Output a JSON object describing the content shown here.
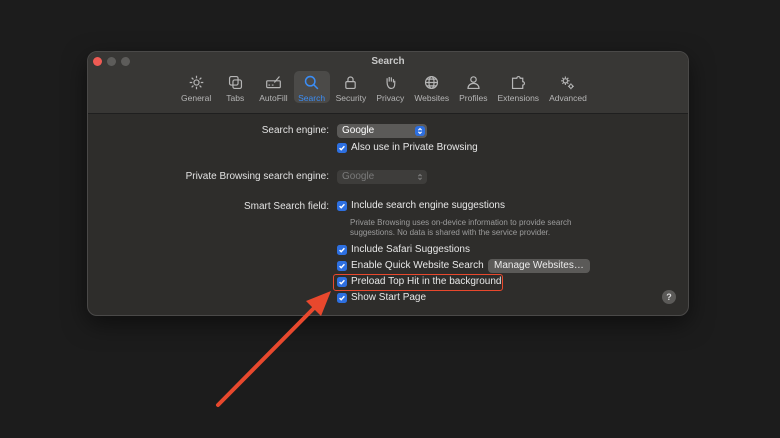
{
  "window": {
    "title": "Search"
  },
  "tabs": [
    {
      "label": "General",
      "icon": "gear-icon"
    },
    {
      "label": "Tabs",
      "icon": "tabs-icon"
    },
    {
      "label": "AutoFill",
      "icon": "autofill-icon"
    },
    {
      "label": "Search",
      "icon": "search-icon",
      "active": true
    },
    {
      "label": "Security",
      "icon": "lock-icon"
    },
    {
      "label": "Privacy",
      "icon": "hand-icon"
    },
    {
      "label": "Websites",
      "icon": "globe-icon"
    },
    {
      "label": "Profiles",
      "icon": "person-icon"
    },
    {
      "label": "Extensions",
      "icon": "puzzle-icon"
    },
    {
      "label": "Advanced",
      "icon": "gears-icon"
    }
  ],
  "search_engine": {
    "label": "Search engine:",
    "value": "Google",
    "private_browsing_checkbox": "Also use in Private Browsing"
  },
  "private_search_engine": {
    "label": "Private Browsing search engine:",
    "value": "Google"
  },
  "smart_search": {
    "label": "Smart Search field:",
    "include_suggestions": "Include search engine suggestions",
    "helper_text": "Private Browsing uses on-device information to provide search suggestions. No data is shared with the service provider.",
    "safari_suggestions": "Include Safari Suggestions",
    "quick_website_search": "Enable Quick Website Search",
    "manage_websites": "Manage Websites…",
    "preload_top_hit": "Preload Top Hit in the background",
    "show_start_page": "Show Start Page"
  },
  "help": {
    "label": "?"
  },
  "colors": {
    "accent": "#2d6fe0",
    "highlight": "#e8482d",
    "active_tab": "#3b8df5"
  }
}
